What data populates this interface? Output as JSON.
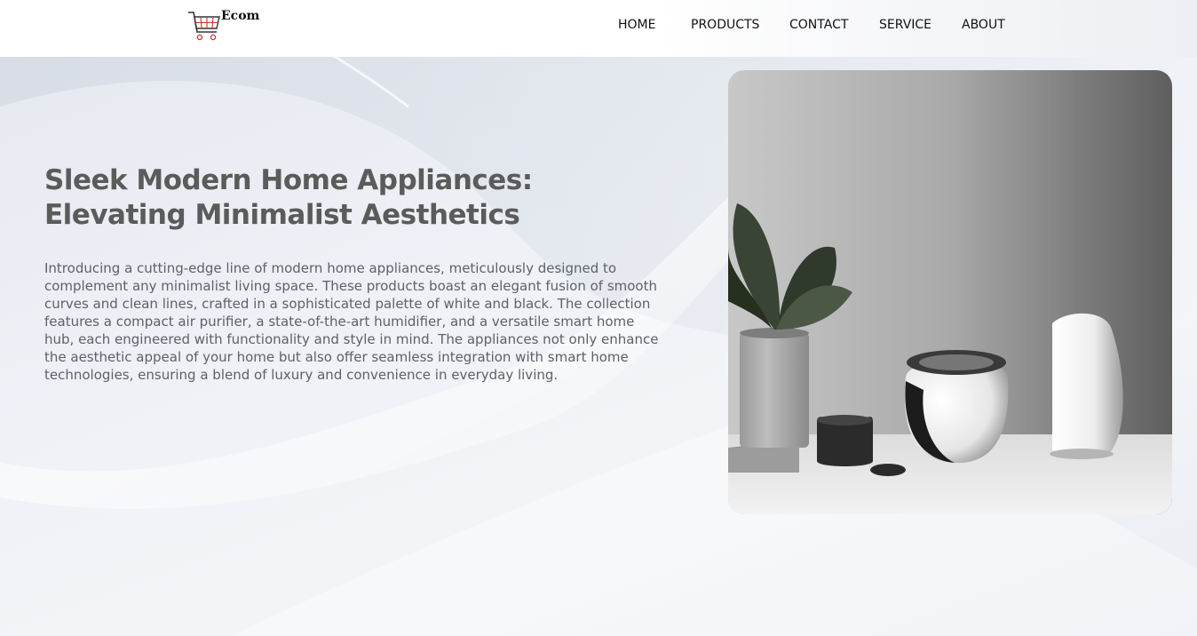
{
  "brand": {
    "name": "Ecom",
    "logo_icon": "shopping-cart-icon"
  },
  "nav": {
    "items": [
      {
        "label": "HOME"
      },
      {
        "label": "PRODUCTS"
      },
      {
        "label": "CONTACT"
      },
      {
        "label": "SERVICE"
      },
      {
        "label": "ABOUT"
      }
    ]
  },
  "hero": {
    "title": "Sleek Modern Home Appliances: Elevating Minimalist Aesthetics",
    "description": "Introducing a cutting-edge line of modern home appliances, meticulously designed to complement any minimalist living space. These products boast an elegant fusion of smooth curves and clean lines, crafted in a sophisticated palette of white and black. The collection features a compact air purifier, a state-of-the-art humidifier, and a versatile smart home hub, each engineered with functionality and style in mind. The appliances not only enhance the aesthetic appeal of your home but also offer seamless integration with smart home technologies, ensuring a blend of luxury and convenience in everyday living.",
    "image": "product-showcase-photo"
  },
  "colors": {
    "title": "#5b5b5b",
    "body_text": "#5f6166",
    "nav_text": "#111111",
    "cart_accent": "#c0392b"
  }
}
